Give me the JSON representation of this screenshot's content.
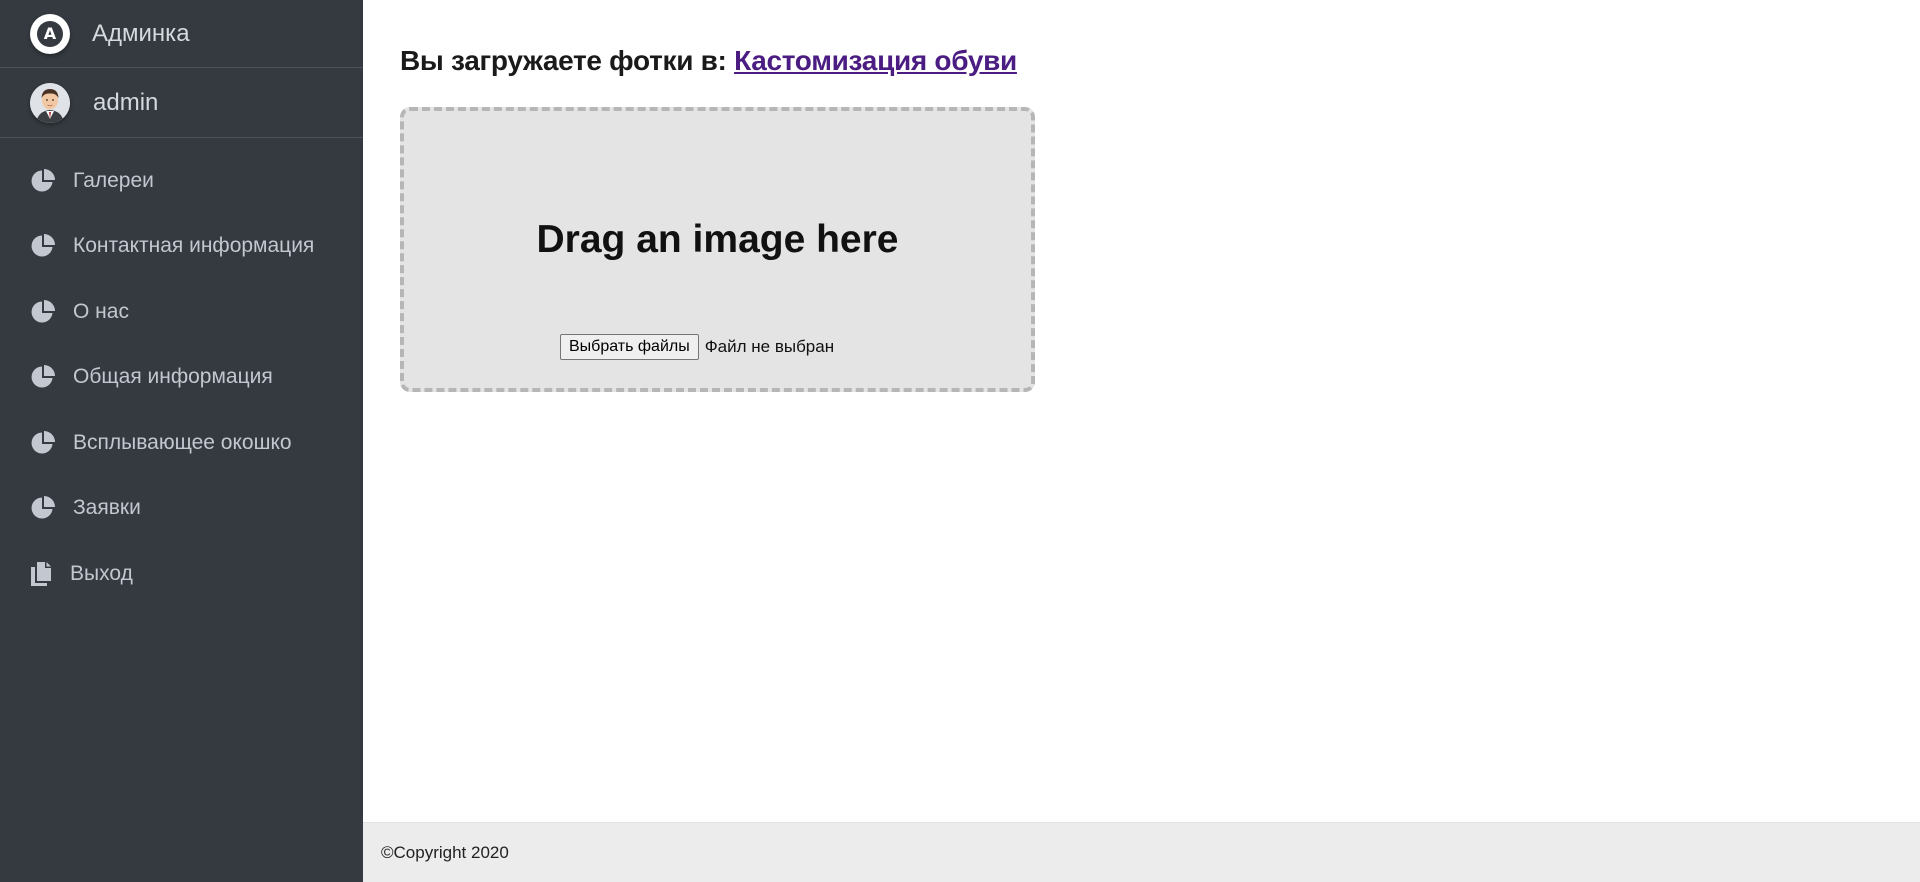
{
  "sidebar": {
    "brand": {
      "label": "Админка",
      "icon": "brand-logo-icon"
    },
    "user": {
      "name": "admin",
      "avatar": "user-avatar"
    },
    "items": [
      {
        "label": "Галереи",
        "icon": "pie-chart-icon"
      },
      {
        "label": "Контактная информация",
        "icon": "pie-chart-icon"
      },
      {
        "label": "О нас",
        "icon": "pie-chart-icon"
      },
      {
        "label": "Общая информация",
        "icon": "pie-chart-icon"
      },
      {
        "label": "Всплывающее окошко",
        "icon": "pie-chart-icon"
      },
      {
        "label": "Заявки",
        "icon": "pie-chart-icon"
      },
      {
        "label": "Выход",
        "icon": "copy-icon"
      }
    ]
  },
  "main": {
    "title_prefix": "Вы загружаете фотки в:",
    "title_link": "Кастомизация обуви",
    "dropzone": {
      "text": "Drag an image here",
      "button_label": "Выбрать файлы",
      "file_status": "Файл не выбран"
    }
  },
  "footer": {
    "copyright": "©Copyright 2020"
  },
  "colors": {
    "sidebar_bg": "#343a40",
    "sidebar_text": "#c2c7d0",
    "link": "#4b1c82",
    "dropzone_bg": "#e4e4e4",
    "dropzone_border": "#b6b6b6",
    "footer_bg": "#ececec"
  }
}
